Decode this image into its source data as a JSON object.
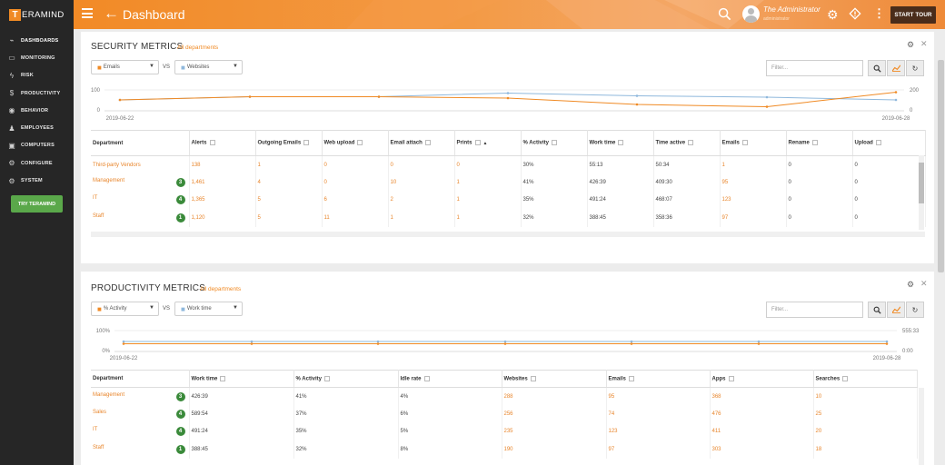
{
  "app": {
    "logo_letter": "T",
    "logo_text": "ERAMIND"
  },
  "sidebar": {
    "items": [
      {
        "label": "DASHBOARDS",
        "icon": "dashboard-icon",
        "glyph": "⌁"
      },
      {
        "label": "MONITORING",
        "icon": "monitoring-icon",
        "glyph": "▭"
      },
      {
        "label": "RISK",
        "icon": "risk-icon",
        "glyph": "ϟ"
      },
      {
        "label": "PRODUCTIVITY",
        "icon": "productivity-icon",
        "glyph": "$"
      },
      {
        "label": "BEHAVIOR",
        "icon": "behavior-icon",
        "glyph": "◉"
      },
      {
        "label": "EMPLOYEES",
        "icon": "employees-icon",
        "glyph": "♟"
      },
      {
        "label": "COMPUTERS",
        "icon": "computers-icon",
        "glyph": "▣"
      },
      {
        "label": "CONFIGURE",
        "icon": "configure-icon",
        "glyph": "⚙"
      },
      {
        "label": "SYSTEM",
        "icon": "system-icon",
        "glyph": "⚙"
      }
    ],
    "try_label": "TRY TERAMIND"
  },
  "header": {
    "title": "Dashboard",
    "user_name": "The Administrator",
    "user_sub": "administrator",
    "start_tour": "START TOUR"
  },
  "security": {
    "title": "SECURITY METRICS",
    "subtitle": "All departments",
    "select1": "Emails",
    "select2": "Websites",
    "vs": "VS",
    "filter_placeholder": "Filter...",
    "chart": {
      "y_left_top": "100",
      "y_left_bottom": "0",
      "y_right_top": "200",
      "y_right_bottom": "0",
      "date_start": "2019-06-22",
      "date_end": "2019-06-28"
    },
    "columns": [
      "Department",
      "Alerts",
      "Outgoing Emails",
      "Web upload",
      "Email attach",
      "Prints",
      "% Activity",
      "Work time",
      "Time active",
      "Emails",
      "Rename",
      "Upload"
    ],
    "rows": [
      {
        "dept": "Third-party Vendors",
        "badge": "",
        "alerts": "138",
        "out": "1",
        "web": "0",
        "attach": "0",
        "prints": "0",
        "activity": "30%",
        "work": "55:13",
        "active": "50:34",
        "emails": "1",
        "rename": "0",
        "upload": "0"
      },
      {
        "dept": "Management",
        "badge": "3",
        "alerts": "1,461",
        "out": "4",
        "web": "0",
        "attach": "10",
        "prints": "1",
        "activity": "41%",
        "work": "426:39",
        "active": "409:30",
        "emails": "95",
        "rename": "0",
        "upload": "0"
      },
      {
        "dept": "IT",
        "badge": "4",
        "alerts": "1,365",
        "out": "5",
        "web": "6",
        "attach": "2",
        "prints": "1",
        "activity": "35%",
        "work": "491:24",
        "active": "468:07",
        "emails": "123",
        "rename": "0",
        "upload": "0"
      },
      {
        "dept": "Staff",
        "badge": "1",
        "alerts": "1,120",
        "out": "5",
        "web": "11",
        "attach": "1",
        "prints": "1",
        "activity": "32%",
        "work": "388:45",
        "active": "358:36",
        "emails": "97",
        "rename": "0",
        "upload": "0"
      }
    ]
  },
  "productivity": {
    "title": "PRODUCTIVITY METRICS",
    "subtitle": "All departments",
    "select1": "% Activity",
    "select2": "Work time",
    "vs": "VS",
    "filter_placeholder": "Filter...",
    "chart": {
      "y_left_top": "100%",
      "y_left_bottom": "0%",
      "y_right_top": "555:33",
      "y_right_bottom": "0:00",
      "date_start": "2019-06-22",
      "date_end": "2019-06-28"
    },
    "columns": [
      "Department",
      "Work time",
      "% Activity",
      "Idle rate",
      "Websites",
      "Emails",
      "Apps",
      "Searches"
    ],
    "rows": [
      {
        "dept": "Management",
        "badge": "3",
        "work": "426:39",
        "activity": "41%",
        "idle": "4%",
        "websites": "288",
        "emails": "95",
        "apps": "368",
        "searches": "10"
      },
      {
        "dept": "Sales",
        "badge": "4",
        "work": "589:54",
        "activity": "37%",
        "idle": "6%",
        "websites": "256",
        "emails": "74",
        "apps": "476",
        "searches": "25"
      },
      {
        "dept": "IT",
        "badge": "4",
        "work": "491:24",
        "activity": "35%",
        "idle": "5%",
        "websites": "235",
        "emails": "123",
        "apps": "411",
        "searches": "20"
      },
      {
        "dept": "Staff",
        "badge": "1",
        "work": "388:45",
        "activity": "32%",
        "idle": "8%",
        "websites": "190",
        "emails": "97",
        "apps": "303",
        "searches": "18"
      }
    ]
  },
  "colors": {
    "accent": "#f08a24",
    "series_orange": "#f08a24",
    "series_blue": "#8fb8dc",
    "badge_green": "#3a8a3a",
    "try_green": "#5aa84a"
  }
}
